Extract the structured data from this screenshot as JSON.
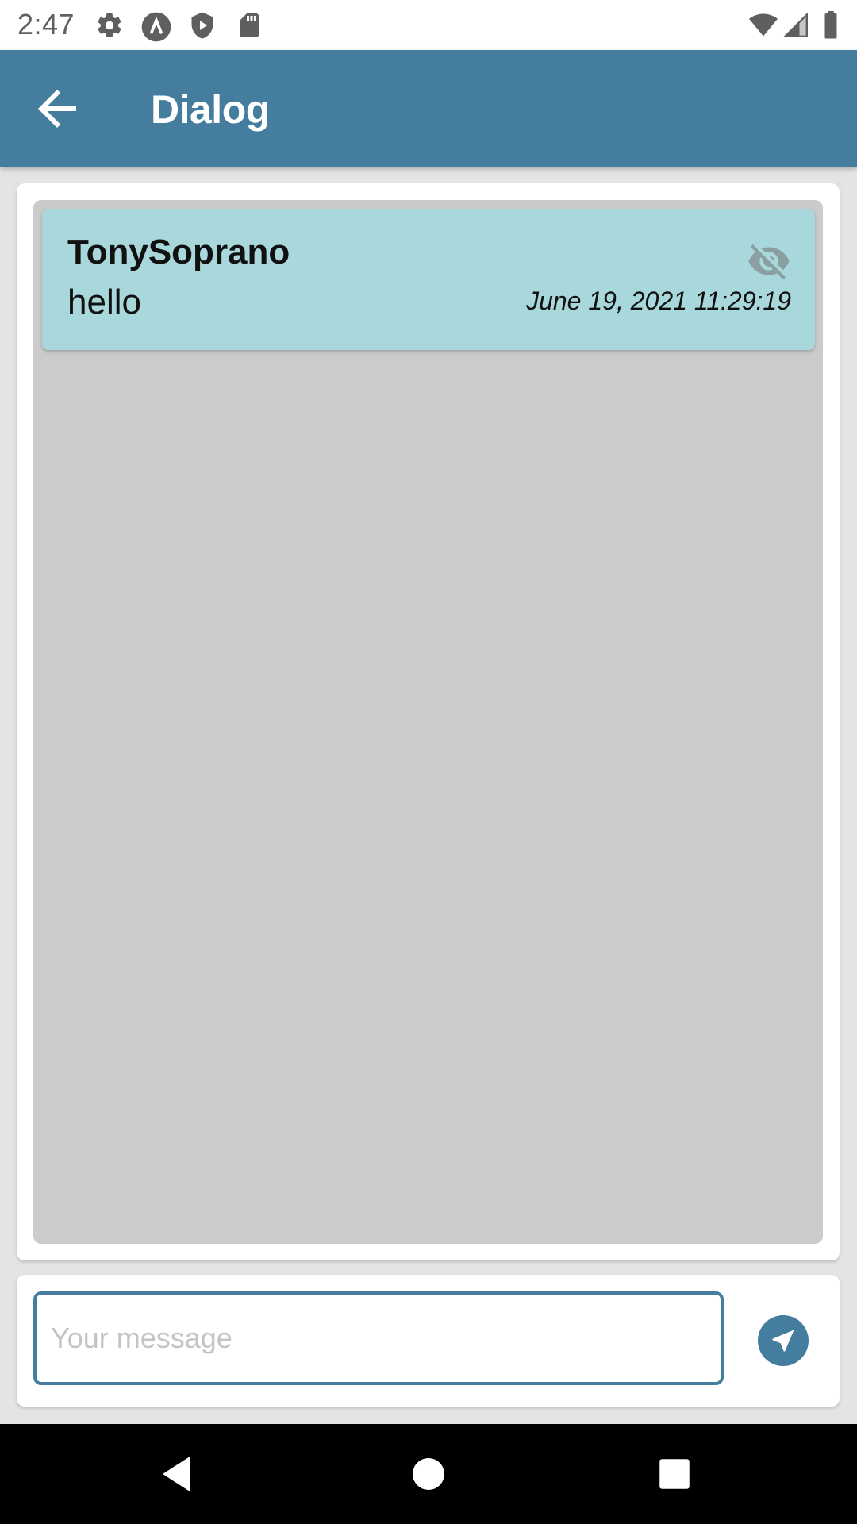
{
  "status_bar": {
    "time": "2:47",
    "icons": [
      "settings-icon",
      "app-a-icon",
      "shield-play-icon",
      "sd-card-icon",
      "wifi-icon",
      "signal-icon",
      "battery-icon"
    ]
  },
  "app_bar": {
    "title": "Dialog",
    "back_icon": "arrow-back-icon"
  },
  "messages": [
    {
      "author": "TonySoprano",
      "text": "hello",
      "timestamp": "June 19, 2021 11:29:19",
      "status_icon": "eye-off-icon"
    }
  ],
  "composer": {
    "placeholder": "Your message",
    "value": "",
    "send_icon": "navigation-arrow-icon"
  },
  "colors": {
    "primary": "#457d9f",
    "bubble": "#a8d8db",
    "chat_background": "#cbcbcb"
  },
  "nav_bar": {
    "buttons": [
      "back-triangle-icon",
      "home-circle-icon",
      "recents-square-icon"
    ]
  }
}
